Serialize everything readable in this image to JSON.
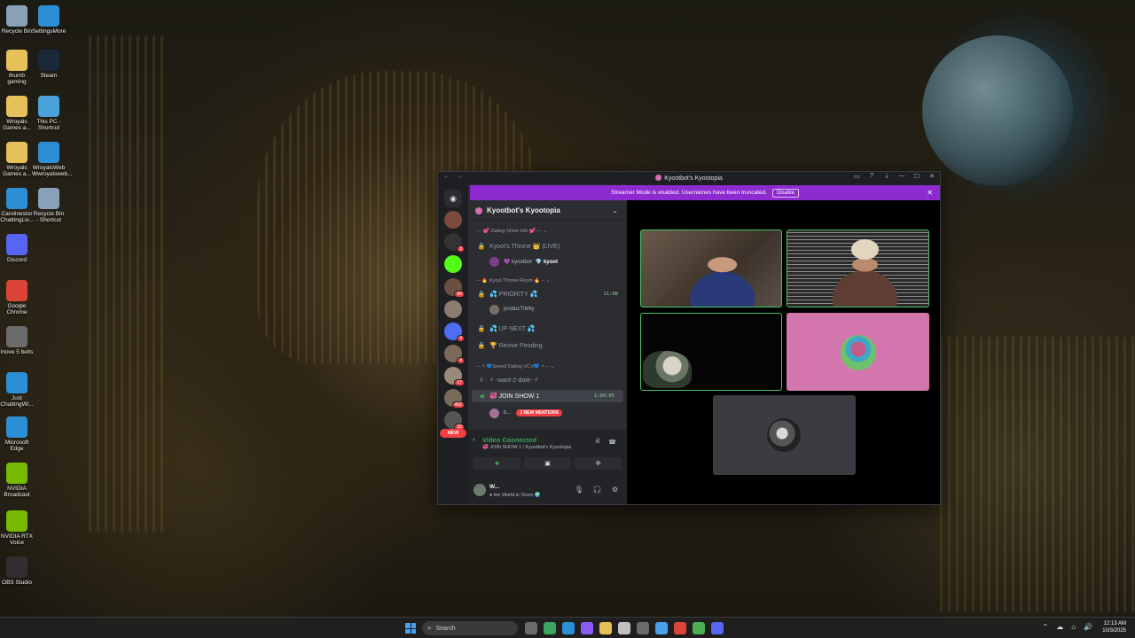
{
  "desktop": {
    "icons": [
      {
        "label": "Recycle Bin",
        "icon": "recycle-bin-icon",
        "color": "#8aa0b8"
      },
      {
        "label": "SettingsMore",
        "icon": "edge-icon",
        "color": "#2c8fd6"
      },
      {
        "label": "thumb gaming",
        "icon": "folder-icon",
        "color": "#e6c15a"
      },
      {
        "label": "Steam",
        "icon": "steam-icon",
        "color": "#1b2838"
      },
      {
        "label": "Wroyals Games a...",
        "icon": "folder-icon",
        "color": "#e6c15a"
      },
      {
        "label": "This PC - Shortcut",
        "icon": "monitor-icon",
        "color": "#4aa3d8"
      },
      {
        "label": "Wroyals Games a...",
        "icon": "folder-icon",
        "color": "#e6c15a"
      },
      {
        "label": "WroyalsWeb Wwroyalsweb...",
        "icon": "edge-icon",
        "color": "#2c8fd6"
      },
      {
        "label": "Carolinestor ChattingLiv...",
        "icon": "edge-icon",
        "color": "#2c8fd6"
      },
      {
        "label": "Recycle Bin - Shortcut",
        "icon": "recycle-bin-icon",
        "color": "#8aa0b8"
      },
      {
        "label": "Discord",
        "icon": "discord-icon",
        "color": "#5865f2"
      },
      {
        "label": "Google Chrome",
        "icon": "chrome-icon",
        "color": "#db4437"
      },
      {
        "label": "Inove 5 belts",
        "icon": "image-icon",
        "color": "#6a6a6a"
      },
      {
        "label": "Just ChattingWi...",
        "icon": "edge-icon",
        "color": "#2c8fd6"
      },
      {
        "label": "Microsoft Edge",
        "icon": "edge-icon",
        "color": "#2c8fd6"
      },
      {
        "label": "NVIDIA Broadcast",
        "icon": "nvidia-icon",
        "color": "#76b900"
      },
      {
        "label": "NVIDIA RTX Voice",
        "icon": "nvidia-icon",
        "color": "#76b900"
      },
      {
        "label": "OBS Studio",
        "icon": "obs-icon",
        "color": "#302e31"
      }
    ]
  },
  "window": {
    "title": "Kyootbot's Kyootopia",
    "nav": "← →",
    "controls": [
      "▭",
      "?",
      "⤓",
      "—",
      "☐",
      "✕"
    ]
  },
  "streamer_banner": {
    "text": "Streamer Mode is enabled. Usernames have been truncated.",
    "button": "Disable",
    "close": "✕"
  },
  "servers": {
    "badges": [
      "",
      "3",
      "",
      "88",
      "",
      "4",
      "4",
      "17",
      "492",
      "35"
    ],
    "colors": [
      "#7a4a3a",
      "#333",
      "#53fc18",
      "#6b5040",
      "#8b7d70",
      "#4c6ef5",
      "#7b6a5a",
      "#9a8a7a",
      "#7a6a5a",
      "#555"
    ],
    "new_pill": "NEW"
  },
  "guild": {
    "name": "Kyootbot's Kyootopia",
    "chevron": "⌄"
  },
  "channels": {
    "cat1": "----💕 Dating Show Info 💕---- ⌄",
    "throne": "Kyoot's Throne 👑 (LIVE)",
    "user1_name": "💜 kyootbot",
    "user1_tag": "💎 kyoot",
    "cat2": "-- 🔥 Kyoot Throne Room 🔥 -- ⌄",
    "priority": "💦 PRIORITY 💦",
    "priority_time": "11:08",
    "user2_name": "producTIMity",
    "upnext": "💦 UP NEXT 💦",
    "revive": "🏆 Revive Pending",
    "cat3": "-- ⚡ 💙Speed Dating VC's💙 ⚡ -- ⌄",
    "want2date": "⚡ -want-2-date- ⚡",
    "joinshow": "💞 JOIN SHOW 1",
    "joinshow_time": "1:00:05",
    "user3_name": "b...",
    "mentions": "2 NEW MENTIONS"
  },
  "voice": {
    "title": "Video Connected",
    "subtitle": "💞 JOIN SHOW 1 / Kyootbot's Kyootopia"
  },
  "user": {
    "name": "W...",
    "status": "● the World is Yours 🌍"
  },
  "taskbar": {
    "search_placeholder": "Search",
    "time": "12:13 AM",
    "date": "10/3/2025",
    "app_colors": [
      "#6b6b6b",
      "#3ba55d",
      "#2c8fd6",
      "#8a5cf6",
      "#e6c15a",
      "#c0c0c0",
      "#6b6b6b",
      "#4aa0ea",
      "#db4437",
      "#4caf50",
      "#5865f2"
    ]
  }
}
